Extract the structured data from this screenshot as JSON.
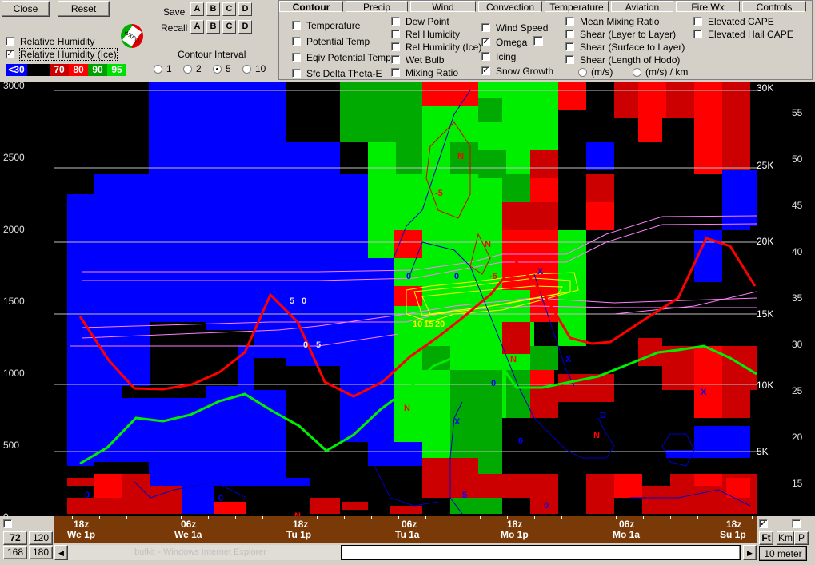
{
  "toolbar": {
    "close_label": "Close",
    "reset_label": "Reset",
    "save_label": "Save",
    "recall_label": "Recall",
    "slots": [
      "A",
      "B",
      "C",
      "D"
    ],
    "rh_label": "Relative Humidity",
    "rh_ice_label": "Relative Humidity (Ice)",
    "rh_ice_checked": true,
    "contour_interval_label": "Contour Interval",
    "contour_interval_options": [
      "1",
      "2",
      "5",
      "10"
    ],
    "contour_interval_selected": "5"
  },
  "legend": [
    {
      "text": "<30",
      "bg": "#0000ff",
      "fg": "#ffffff"
    },
    {
      "text": "",
      "bg": "#000000",
      "fg": "#ffffff"
    },
    {
      "text": "70",
      "bg": "#c80000",
      "fg": "#ffffff"
    },
    {
      "text": "80",
      "bg": "#ff0000",
      "fg": "#ffffff"
    },
    {
      "text": "90",
      "bg": "#00a000",
      "fg": "#ffffff"
    },
    {
      "text": "95",
      "bg": "#00e000",
      "fg": "#ffffff"
    }
  ],
  "tabs": [
    {
      "label": "Contour",
      "active": true
    },
    {
      "label": "Precip",
      "active": false
    },
    {
      "label": "Wind",
      "active": false
    },
    {
      "label": "Convection",
      "active": false
    },
    {
      "label": "Temperature",
      "active": false
    },
    {
      "label": "Aviation",
      "active": false
    },
    {
      "label": "Fire Wx",
      "active": false
    },
    {
      "label": "Controls",
      "active": false
    }
  ],
  "contour_options": {
    "col1": [
      {
        "label": "Temperature",
        "checked": false
      },
      {
        "label": "Potential Temp",
        "checked": false
      },
      {
        "label": "Eqiv Potential Temp",
        "checked": false
      },
      {
        "label": "Sfc Delta Theta-E",
        "checked": false
      }
    ],
    "col2": [
      {
        "label": "Dew Point",
        "checked": false
      },
      {
        "label": "Rel Humidity",
        "checked": false
      },
      {
        "label": "Rel Humidity (Ice)",
        "checked": false
      },
      {
        "label": "Wet Bulb",
        "checked": false
      },
      {
        "label": "Mixing Ratio",
        "checked": false
      }
    ],
    "col3": [
      {
        "label": "Wind Speed",
        "checked": false
      },
      {
        "label": "Omega",
        "checked": true
      },
      {
        "label": "Icing",
        "checked": false
      },
      {
        "label": "Snow Growth",
        "checked": true
      }
    ],
    "col4": [
      {
        "label": "Mean Mixing Ratio",
        "checked": false
      },
      {
        "label": "Shear (Layer to Layer)",
        "checked": false
      },
      {
        "label": "Shear (Surface to Layer)",
        "checked": false
      },
      {
        "label": "Shear (Length of Hodo)",
        "checked": false
      }
    ],
    "shear_units": [
      "(m/s)",
      "(m/s) / km"
    ],
    "col5": [
      {
        "label": "Elevated CAPE",
        "checked": false
      },
      {
        "label": "Elevated Hail CAPE",
        "checked": false
      }
    ]
  },
  "chart_data": {
    "type": "heatmap",
    "title": "",
    "left_axis_ticks": [
      "3000",
      "2500",
      "2000",
      "1500",
      "1000",
      "500",
      "0"
    ],
    "right_height_labels": [
      "30K",
      "25K",
      "20K",
      "15K",
      "10K",
      "5K"
    ],
    "right_axis_ticks": [
      "55",
      "50",
      "45",
      "40",
      "35",
      "30",
      "25",
      "20",
      "15"
    ],
    "time_labels": [
      {
        "z": "18z",
        "day": "We 1p"
      },
      {
        "z": "06z",
        "day": "We 1a"
      },
      {
        "z": "18z",
        "day": "Tu 1p"
      },
      {
        "z": "06z",
        "day": "Tu 1a"
      },
      {
        "z": "18z",
        "day": "Mo 1p"
      },
      {
        "z": "06z",
        "day": "Mo 1a"
      },
      {
        "z": "18z",
        "day": "Su 1p"
      }
    ],
    "contour_labels": [
      "N",
      "-5",
      "N",
      "-5",
      "0",
      "0",
      "5",
      "0",
      "10",
      "15",
      "20",
      "0",
      "5",
      "N",
      "N",
      "X",
      "X",
      "X",
      "X",
      "0",
      "D",
      "N",
      "0",
      "0",
      "0",
      "5",
      "0",
      "0",
      "N"
    ]
  },
  "bottom": {
    "hour_buttons": [
      "72",
      "120",
      "168",
      "180"
    ],
    "unit_buttons": [
      "Ft",
      "Km",
      "P"
    ],
    "meter_label": "10 meter",
    "taskbar_text": "bufkit - Windows Internet Explorer"
  }
}
